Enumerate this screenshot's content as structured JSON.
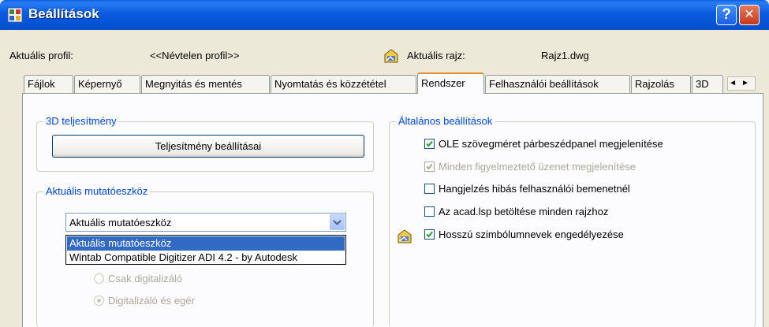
{
  "window": {
    "title": "Beállítások",
    "help_label": "?",
    "close_label": "✕",
    "app_icon": "settings-dialog-icon"
  },
  "profile": {
    "label": "Aktuális profil:",
    "value": "<<Névtelen profil>>"
  },
  "drawing": {
    "label": "Aktuális rajz:",
    "value": "Rajz1.dwg",
    "icon": "drawing-file-icon"
  },
  "tabs": [
    {
      "label": "Fájlok"
    },
    {
      "label": "Képernyő"
    },
    {
      "label": "Megnyitás és mentés"
    },
    {
      "label": "Nyomtatás és közzététel"
    },
    {
      "label": "Rendszer",
      "active": true
    },
    {
      "label": "Felhasználói beállítások"
    },
    {
      "label": "Rajzolás"
    },
    {
      "label": "3D"
    }
  ],
  "tab_scroll": {
    "left": "◄",
    "right": "►"
  },
  "performance": {
    "legend": "3D teljesítmény",
    "button_label": "Teljesítmény beállításai"
  },
  "pointing": {
    "legend": "Aktuális mutatóeszköz",
    "selected": "Aktuális mutatóeszköz",
    "options": [
      "Aktuális mutatóeszköz",
      "Wintab Compatible Digitizer ADI 4.2 - by Autodesk"
    ],
    "radios": [
      {
        "label": "Csak digitalizáló",
        "checked": false
      },
      {
        "label": "Digitalizáló és egér",
        "checked": true
      }
    ]
  },
  "general": {
    "legend": "Általános beállítások",
    "checkboxes": [
      {
        "label": "OLE szövegméret párbeszédpanel megjelenítése",
        "checked": true,
        "enabled": true
      },
      {
        "label": "Minden figyelmeztető üzenet megjelenítése",
        "checked": true,
        "enabled": false
      },
      {
        "label": "Hangjelzés hibás felhasználói bemenetnél",
        "checked": false,
        "enabled": true
      },
      {
        "label": "Az acad.lsp betöltése minden rajzhoz",
        "checked": false,
        "enabled": true
      },
      {
        "label": "Hosszú szimbólumnevek engedélyezése",
        "checked": true,
        "enabled": true
      }
    ],
    "symbol_icon": "drawing-file-icon"
  }
}
